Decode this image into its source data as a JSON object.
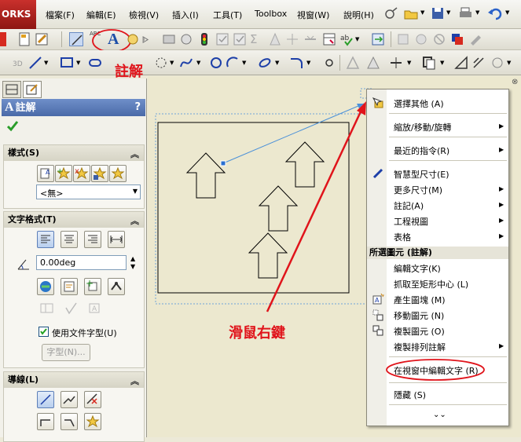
{
  "app": {
    "logo_text": "ORKS"
  },
  "menu": [
    "檔案(F)",
    "編輯(E)",
    "檢視(V)",
    "插入(I)",
    "工具(T)",
    "Toolbox",
    "視窗(W)",
    "說明(H)"
  ],
  "annotations": {
    "note_label": "註解",
    "right_click_label": "滑鼠右鍵"
  },
  "panel": {
    "title": "註解",
    "help": "?",
    "ok_icon": "checkmark-icon",
    "style_group": {
      "title": "樣式(S)",
      "select_value": "<無>"
    },
    "text_format_group": {
      "title": "文字格式(T)",
      "angle_value": "0.00deg",
      "use_doc_font_label": "使用文件字型(U)",
      "use_doc_font_checked": true,
      "font_button": "字型(N)..."
    },
    "leader_group": {
      "title": "導線(L)"
    }
  },
  "context_menu": {
    "items_top": [
      {
        "label": "選擇其他 (A)",
        "arrow": false
      },
      {
        "label": "縮放/移動/旋轉",
        "arrow": true
      },
      {
        "label": "最近的指令(R)",
        "arrow": true
      },
      {
        "label": "智慧型尺寸(E)",
        "arrow": false
      },
      {
        "label": "更多尺寸(M)",
        "arrow": true
      },
      {
        "label": "註記(A)",
        "arrow": true
      },
      {
        "label": "工程視圖",
        "arrow": true
      },
      {
        "label": "表格",
        "arrow": true
      }
    ],
    "section_title": "所選圖元 (註解)",
    "items_section": [
      {
        "label": "編輯文字(K)",
        "arrow": false
      },
      {
        "label": "抓取至矩形中心 (L)",
        "arrow": false
      },
      {
        "label": "產生圖塊 (M)",
        "arrow": false
      },
      {
        "label": "移動圖元 (N)",
        "arrow": false
      },
      {
        "label": "複製圖元 (O)",
        "arrow": false
      },
      {
        "label": "複製排列註解",
        "arrow": true
      }
    ],
    "highlighted_item": "在視窗中編輯文字 (R)",
    "hide_item": "隱藏 (S)",
    "expand_icon": "double-chevron-down-icon"
  },
  "colors": {
    "annotation_red": "#e0141b",
    "leader_blue": "#4a90d9",
    "panel_title": "#4a6aa8"
  }
}
